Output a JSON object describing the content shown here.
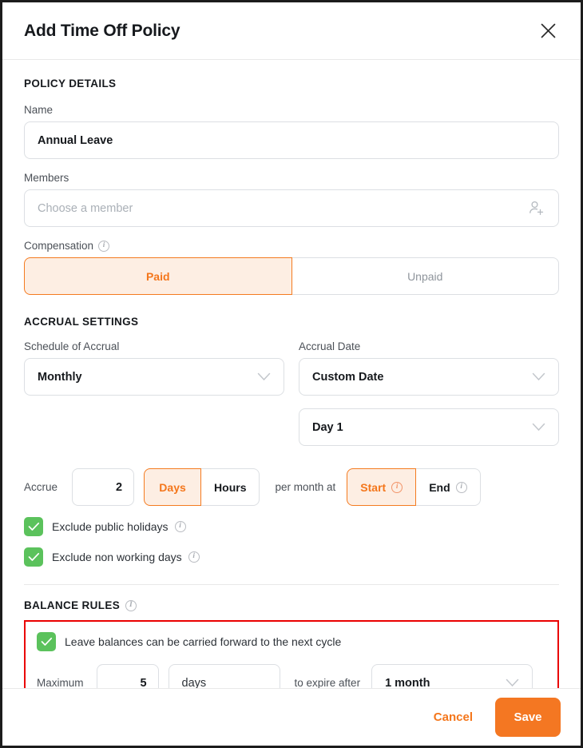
{
  "header": {
    "title": "Add Time Off Policy",
    "close_icon": "close-icon"
  },
  "policy_details": {
    "section_title": "POLICY DETAILS",
    "name_label": "Name",
    "name_value": "Annual Leave",
    "members_label": "Members",
    "members_placeholder": "Choose a member",
    "members_icon": "add-person-icon",
    "compensation_label": "Compensation",
    "compensation_options": [
      "Paid",
      "Unpaid"
    ],
    "compensation_selected": "Paid"
  },
  "accrual_settings": {
    "section_title": "ACCRUAL SETTINGS",
    "schedule_label": "Schedule of Accrual",
    "schedule_value": "Monthly",
    "accrual_date_label": "Accrual Date",
    "accrual_date_value": "Custom Date",
    "accrual_day_value": "Day 1",
    "accrue_label": "Accrue",
    "accrue_amount": "2",
    "unit_options": [
      "Days",
      "Hours"
    ],
    "unit_selected": "Days",
    "per_label": "per month at",
    "timing_options": [
      "Start",
      "End"
    ],
    "timing_selected": "Start",
    "exclude_holidays_label": "Exclude public holidays",
    "exclude_holidays_checked": true,
    "exclude_nonworking_label": "Exclude non working days",
    "exclude_nonworking_checked": true
  },
  "balance_rules": {
    "section_title": "BALANCE RULES",
    "carry_forward_label": "Leave balances can be carried forward to the next cycle",
    "carry_forward_checked": true,
    "maximum_label": "Maximum",
    "maximum_value": "5",
    "maximum_unit": "days",
    "expire_label": "to expire after",
    "expire_value": "1 month"
  },
  "footer": {
    "cancel_label": "Cancel",
    "save_label": "Save"
  },
  "colors": {
    "accent_orange": "#f47722",
    "accent_orange_soft": "#fdeee3",
    "green_check": "#5bc25c",
    "highlight_red": "#ea0000"
  }
}
